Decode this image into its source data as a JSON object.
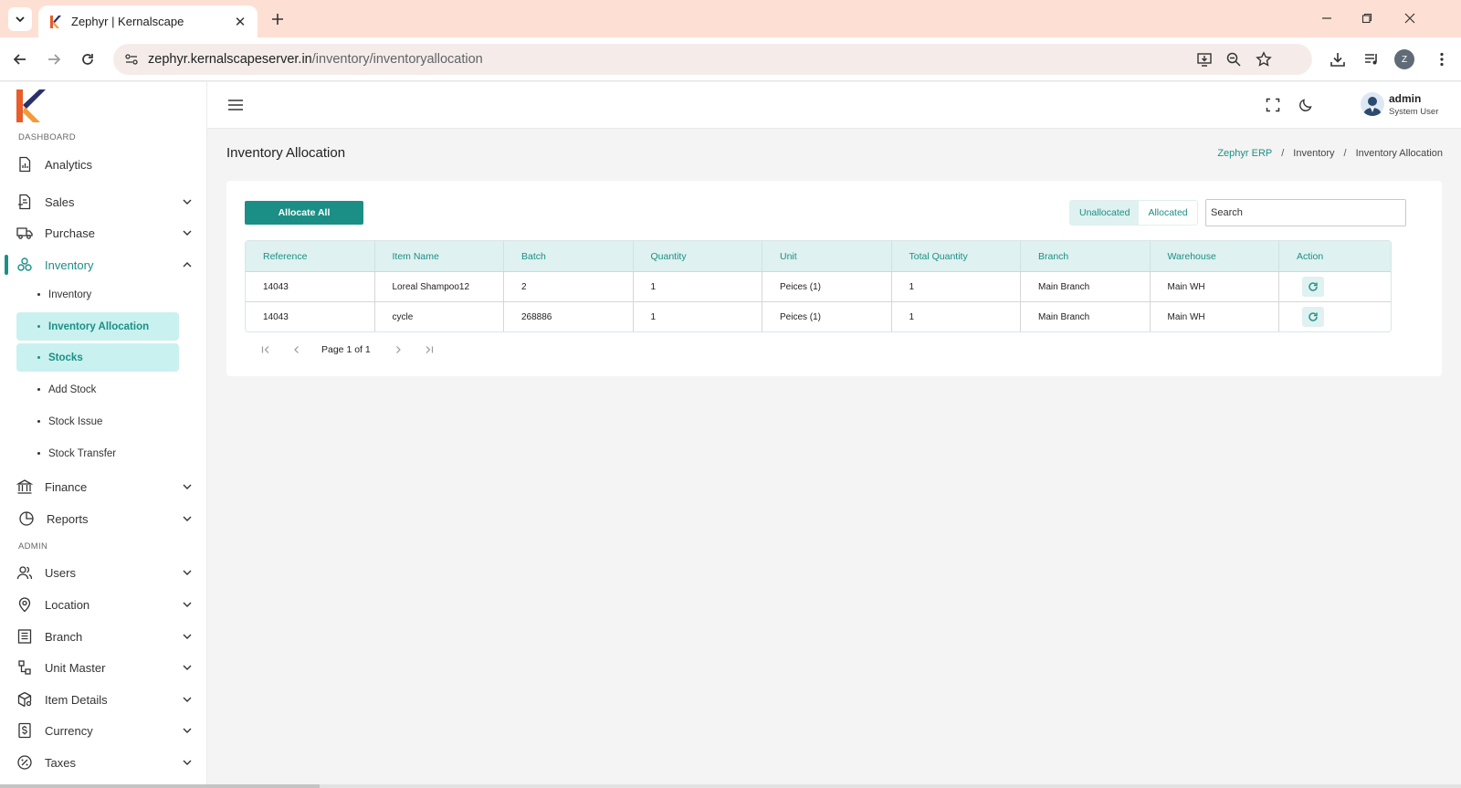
{
  "browser": {
    "tab_title": "Zephyr | Kernalscape",
    "url_host": "zephyr.kernalscapeserver.in",
    "url_path": "/inventory/inventoryallocation",
    "profile_initial": "Z"
  },
  "sidebar": {
    "dashboard_label": "DASHBOARD",
    "admin_label": "ADMIN",
    "items": {
      "analytics": "Analytics",
      "sales": "Sales",
      "purchase": "Purchase",
      "inventory": "Inventory",
      "finance": "Finance",
      "reports": "Reports",
      "users": "Users",
      "location": "Location",
      "branch": "Branch",
      "unit_master": "Unit Master",
      "item_details": "Item Details",
      "currency": "Currency",
      "taxes": "Taxes"
    },
    "inventory_sub": {
      "inventory": "Inventory",
      "inventory_allocation": "Inventory Allocation",
      "stocks": "Stocks",
      "add_stock": "Add Stock",
      "stock_issue": "Stock Issue",
      "stock_transfer": "Stock Transfer"
    }
  },
  "topbar": {
    "user_name": "admin",
    "user_role": "System User"
  },
  "page": {
    "title": "Inventory Allocation",
    "breadcrumb": [
      "Zephyr ERP",
      "Inventory",
      "Inventory Allocation"
    ]
  },
  "toolbar": {
    "allocate_all": "Allocate All",
    "tab_unallocated": "Unallocated",
    "tab_allocated": "Allocated",
    "search_placeholder": "Search"
  },
  "table": {
    "headers": [
      "Reference",
      "Item Name",
      "Batch",
      "Quantity",
      "Unit",
      "Total Quantity",
      "Branch",
      "Warehouse",
      "Action"
    ],
    "rows": [
      [
        "14043",
        "Loreal Shampoo12",
        "2",
        "1",
        "Peices (1)",
        "1",
        "Main Branch",
        "Main WH"
      ],
      [
        "14043",
        "cycle",
        "268886",
        "1",
        "Peices (1)",
        "1",
        "Main Branch",
        "Main WH"
      ]
    ]
  },
  "pagination": {
    "text": "Page 1 of 1"
  },
  "colors": {
    "accent": "#1b8f85",
    "accent_light": "#dff1f0",
    "highlight": "#c9f1ef",
    "tabbar": "#fde0d3"
  }
}
